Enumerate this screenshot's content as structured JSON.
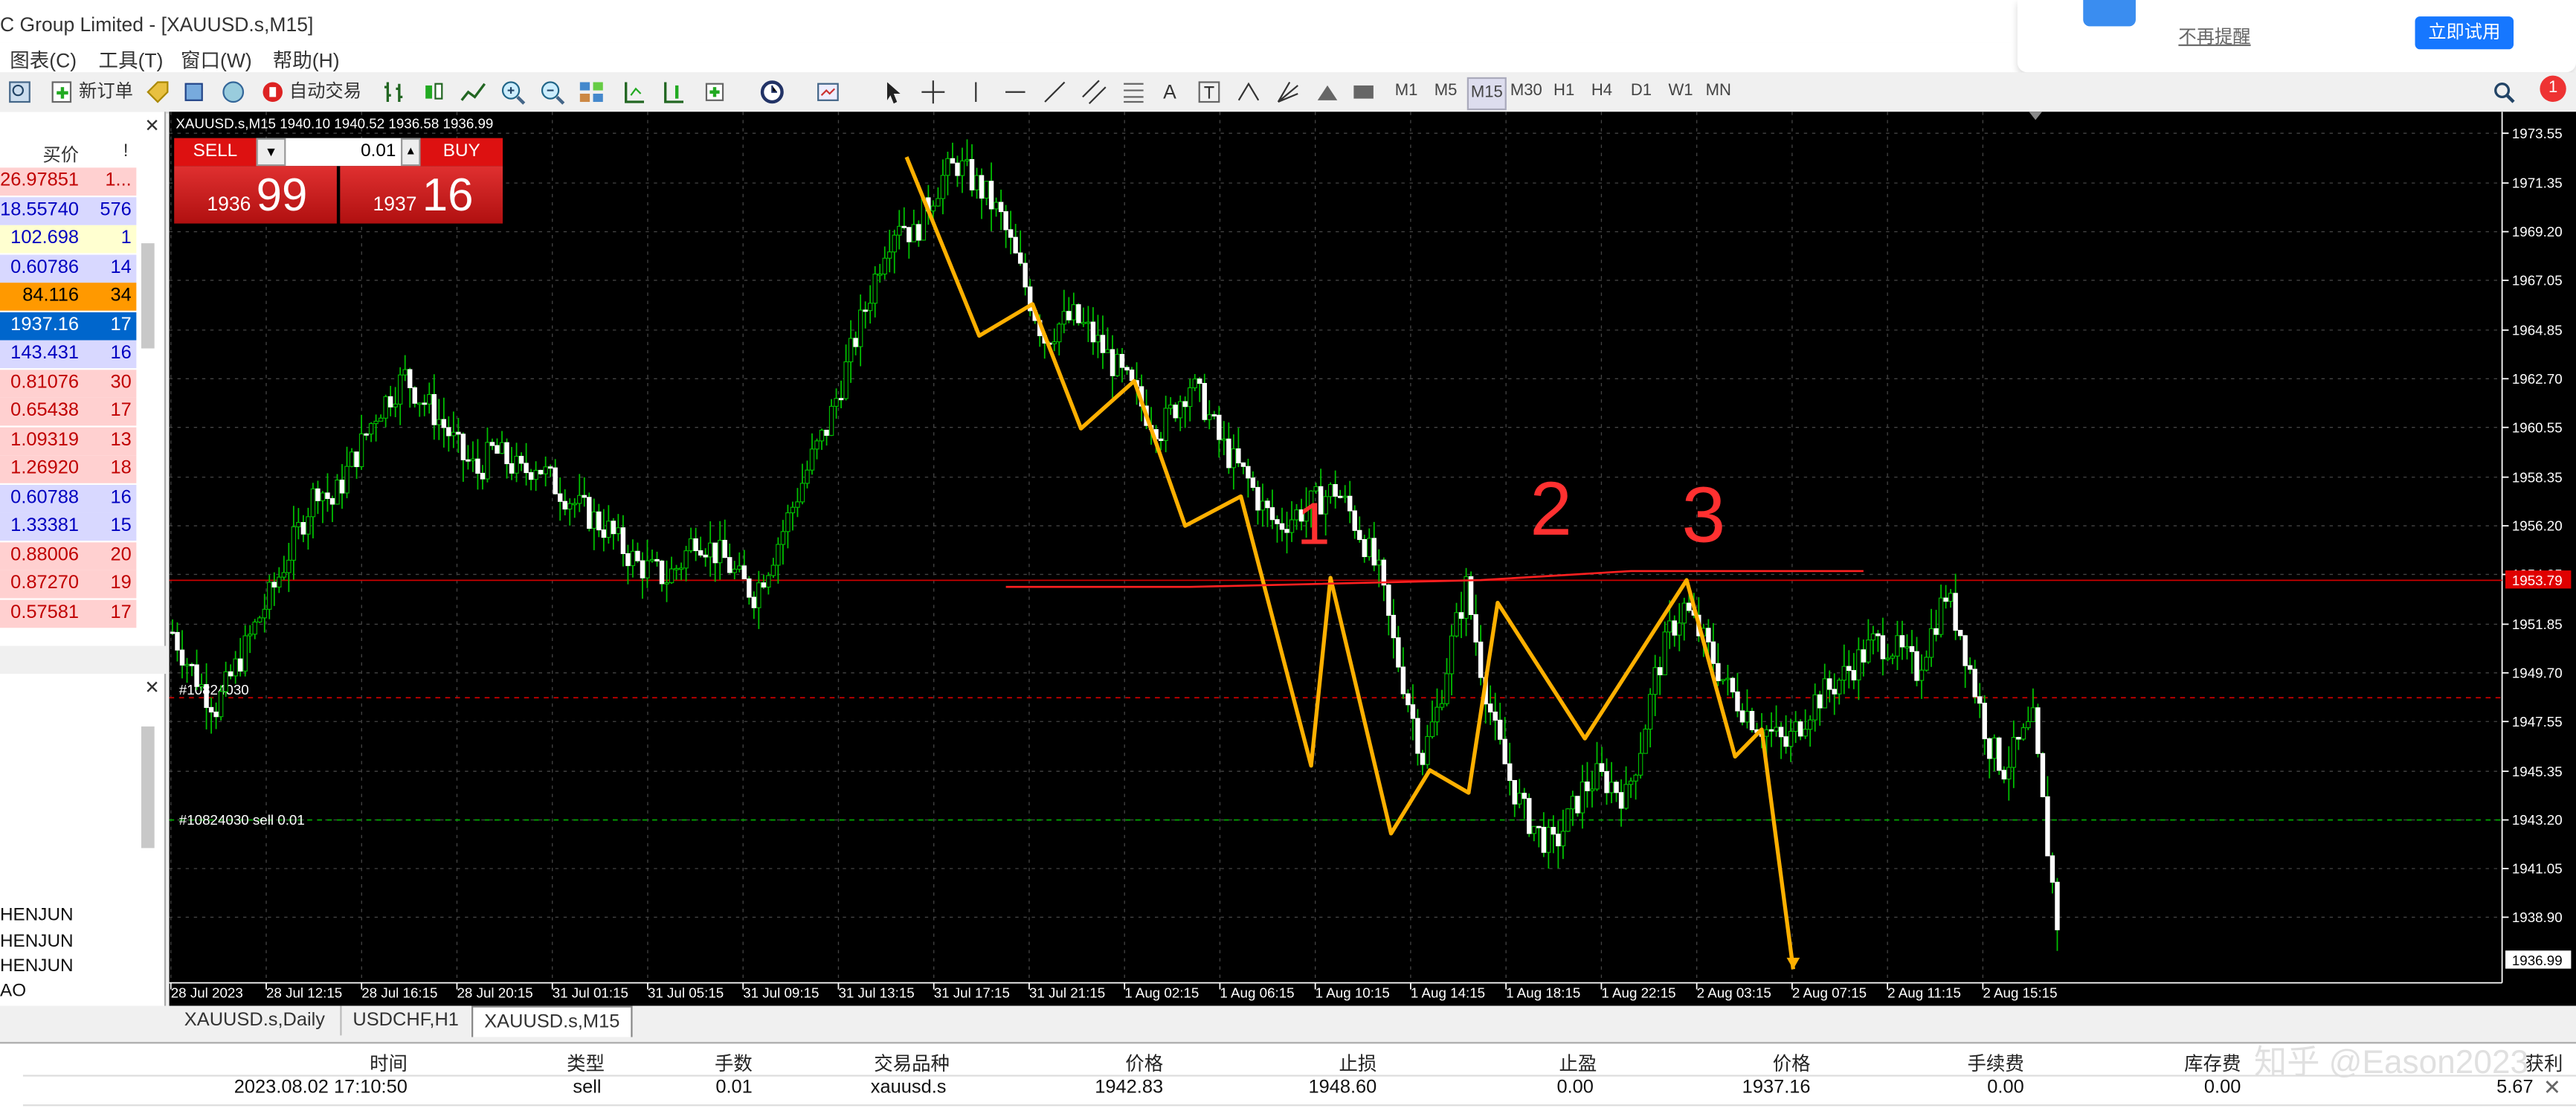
{
  "window": {
    "title": "C Group Limited - [XAUUSD.s,M15]"
  },
  "menu": [
    "图表(C)",
    "工具(T)",
    "窗口(W)",
    "帮助(H)"
  ],
  "toolbar": {
    "new_order": "新订单",
    "auto_trade": "自动交易",
    "timeframes": [
      "M1",
      "M5",
      "M15",
      "M30",
      "H1",
      "H4",
      "D1",
      "W1",
      "MN"
    ],
    "active_timeframe": "M15"
  },
  "popup": {
    "dismiss": "不再提醒",
    "try_now": "立即试用",
    "notif_count": "1"
  },
  "market_watch": {
    "col_bid": "买价",
    "col_bang": "!",
    "rows": [
      {
        "price": "26.97851",
        "spread": "1...",
        "bg": "#ffd0d0",
        "fg": "#c00000"
      },
      {
        "price": "18.55740",
        "spread": "576",
        "bg": "#d8d8ff",
        "fg": "#0000c0"
      },
      {
        "price": "102.698",
        "spread": "1",
        "bg": "#ffffd0",
        "fg": "#0000c0"
      },
      {
        "price": "0.60786",
        "spread": "14",
        "bg": "#d8d8ff",
        "fg": "#0000c0"
      },
      {
        "price": "84.116",
        "spread": "34",
        "bg": "#ff9900",
        "fg": "#000000"
      },
      {
        "price": "1937.16",
        "spread": "17",
        "bg": "#0066cc",
        "fg": "#ffffff"
      },
      {
        "price": "143.431",
        "spread": "16",
        "bg": "#d8d8ff",
        "fg": "#0000c0"
      },
      {
        "price": "0.81076",
        "spread": "30",
        "bg": "#ffd0d0",
        "fg": "#c00000"
      },
      {
        "price": "0.65438",
        "spread": "17",
        "bg": "#ffd0d0",
        "fg": "#c00000"
      },
      {
        "price": "1.09319",
        "spread": "13",
        "bg": "#ffd0d0",
        "fg": "#c00000"
      },
      {
        "price": "1.26920",
        "spread": "18",
        "bg": "#ffd0d0",
        "fg": "#c00000"
      },
      {
        "price": "0.60788",
        "spread": "16",
        "bg": "#d8d8ff",
        "fg": "#0000c0"
      },
      {
        "price": "1.33381",
        "spread": "15",
        "bg": "#d8d8ff",
        "fg": "#0000c0"
      },
      {
        "price": "0.88006",
        "spread": "20",
        "bg": "#ffd0d0",
        "fg": "#c00000"
      },
      {
        "price": "0.87270",
        "spread": "19",
        "bg": "#ffd0d0",
        "fg": "#c00000"
      },
      {
        "price": "0.57581",
        "spread": "17",
        "bg": "#ffd0d0",
        "fg": "#c00000"
      }
    ]
  },
  "navigator": {
    "items": [
      "HENJUN",
      "HENJUN",
      "HENJUN",
      "AO"
    ]
  },
  "one_click": {
    "sell": "SELL",
    "buy": "BUY",
    "volume": "0.01",
    "bid_small": "1936",
    "bid_big": "99",
    "ask_small": "1937",
    "ask_big": "16"
  },
  "chart_data": {
    "type": "candlestick",
    "symbol_info": "XAUUSD.s,M15  1940.10 1940.52 1936.58 1936.99",
    "y_ticks": [
      "1973.55",
      "1971.35",
      "1969.20",
      "1967.05",
      "1964.85",
      "1962.70",
      "1960.55",
      "1958.35",
      "1956.20",
      "1954.05",
      "1951.85",
      "1949.70",
      "1947.55",
      "1945.35",
      "1943.20",
      "1941.05",
      "1938.90"
    ],
    "ylim": [
      1936.0,
      1974.5
    ],
    "x_ticks": [
      "28 Jul 2023",
      "28 Jul 12:15",
      "28 Jul 16:15",
      "28 Jul 20:15",
      "31 Jul 01:15",
      "31 Jul 05:15",
      "31 Jul 09:15",
      "31 Jul 13:15",
      "31 Jul 17:15",
      "31 Jul 21:15",
      "1 Aug 02:15",
      "1 Aug 06:15",
      "1 Aug 10:15",
      "1 Aug 14:15",
      "1 Aug 18:15",
      "1 Aug 22:15",
      "2 Aug 03:15",
      "2 Aug 07:15",
      "2 Aug 11:15",
      "2 Aug 15:15"
    ],
    "close_path": [
      [
        0,
        1951.5
      ],
      [
        6,
        1950.2
      ],
      [
        12,
        1949.1
      ],
      [
        18,
        1948.2
      ],
      [
        24,
        1949.5
      ],
      [
        30,
        1950.8
      ],
      [
        36,
        1952.2
      ],
      [
        42,
        1953.5
      ],
      [
        48,
        1955.0
      ],
      [
        54,
        1956.5
      ],
      [
        60,
        1958.0
      ],
      [
        66,
        1957.2
      ],
      [
        72,
        1958.6
      ],
      [
        78,
        1959.8
      ],
      [
        84,
        1961.2
      ],
      [
        90,
        1962.0
      ],
      [
        96,
        1962.8
      ],
      [
        102,
        1961.9
      ],
      [
        108,
        1961.2
      ],
      [
        114,
        1960.3
      ],
      [
        120,
        1959.2
      ],
      [
        126,
        1958.6
      ],
      [
        132,
        1959.5
      ],
      [
        138,
        1959.1
      ],
      [
        144,
        1958.5
      ],
      [
        150,
        1959.0
      ],
      [
        156,
        1958.2
      ],
      [
        162,
        1957.6
      ],
      [
        168,
        1957.0
      ],
      [
        174,
        1956.5
      ],
      [
        180,
        1956.0
      ],
      [
        186,
        1955.2
      ],
      [
        192,
        1954.5
      ],
      [
        198,
        1954.2
      ],
      [
        204,
        1953.9
      ],
      [
        210,
        1954.6
      ],
      [
        216,
        1955.8
      ],
      [
        222,
        1955.2
      ],
      [
        228,
        1954.7
      ],
      [
        234,
        1953.8
      ],
      [
        240,
        1953.2
      ],
      [
        246,
        1954.5
      ],
      [
        252,
        1956.0
      ],
      [
        258,
        1957.6
      ],
      [
        264,
        1959.2
      ],
      [
        270,
        1960.5
      ],
      [
        276,
        1962.5
      ],
      [
        282,
        1964.5
      ],
      [
        288,
        1966.5
      ],
      [
        294,
        1968.6
      ],
      [
        300,
        1969.8
      ],
      [
        306,
        1969.0
      ],
      [
        312,
        1970.5
      ],
      [
        318,
        1971.6
      ],
      [
        324,
        1972.2
      ],
      [
        330,
        1971.5
      ],
      [
        336,
        1970.8
      ],
      [
        342,
        1969.8
      ],
      [
        348,
        1968.0
      ],
      [
        354,
        1966.2
      ],
      [
        360,
        1964.5
      ],
      [
        366,
        1965.1
      ],
      [
        372,
        1965.4
      ],
      [
        378,
        1964.8
      ],
      [
        384,
        1964.0
      ],
      [
        390,
        1963.1
      ],
      [
        396,
        1962.2
      ],
      [
        402,
        1961.2
      ],
      [
        408,
        1960.5
      ],
      [
        414,
        1961.5
      ],
      [
        420,
        1962.5
      ],
      [
        426,
        1961.5
      ],
      [
        432,
        1960.0
      ],
      [
        438,
        1959.0
      ],
      [
        444,
        1958.2
      ],
      [
        450,
        1957.0
      ],
      [
        456,
        1956.2
      ],
      [
        462,
        1956.6
      ],
      [
        468,
        1957.0
      ],
      [
        474,
        1957.4
      ],
      [
        480,
        1957.8
      ],
      [
        486,
        1956.8
      ],
      [
        492,
        1955.5
      ],
      [
        498,
        1954.0
      ],
      [
        504,
        1951.0
      ],
      [
        510,
        1948.5
      ],
      [
        516,
        1946.0
      ],
      [
        522,
        1948.0
      ],
      [
        528,
        1951.0
      ],
      [
        534,
        1953.5
      ],
      [
        540,
        1950.0
      ],
      [
        546,
        1947.0
      ],
      [
        552,
        1945.0
      ],
      [
        558,
        1943.5
      ],
      [
        564,
        1942.6
      ],
      [
        570,
        1942.0
      ],
      [
        576,
        1943.2
      ],
      [
        582,
        1944.5
      ],
      [
        588,
        1945.1
      ],
      [
        594,
        1944.8
      ],
      [
        600,
        1944.2
      ],
      [
        606,
        1946.5
      ],
      [
        612,
        1949.5
      ],
      [
        618,
        1951.5
      ],
      [
        624,
        1952.6
      ],
      [
        630,
        1951.5
      ],
      [
        636,
        1950.3
      ],
      [
        642,
        1949.0
      ],
      [
        648,
        1948.2
      ],
      [
        654,
        1947.5
      ],
      [
        660,
        1947.0
      ],
      [
        666,
        1946.5
      ],
      [
        672,
        1947.5
      ],
      [
        678,
        1948.5
      ],
      [
        684,
        1949.0
      ],
      [
        690,
        1949.6
      ],
      [
        696,
        1950.3
      ],
      [
        702,
        1951.0
      ],
      [
        708,
        1951.0
      ],
      [
        714,
        1950.5
      ],
      [
        720,
        1949.8
      ],
      [
        726,
        1951.5
      ],
      [
        732,
        1953.2
      ],
      [
        738,
        1951.5
      ],
      [
        744,
        1949.0
      ],
      [
        750,
        1946.5
      ],
      [
        756,
        1945.5
      ],
      [
        762,
        1946.5
      ],
      [
        768,
        1947.5
      ],
      [
        774,
        1942.0
      ],
      [
        780,
        1937.0
      ]
    ],
    "annotations": {
      "zigzag": [
        [
          303,
          1972.5
        ],
        [
          333,
          1964.6
        ],
        [
          355,
          1966.0
        ],
        [
          375,
          1960.5
        ],
        [
          397,
          1962.6
        ],
        [
          418,
          1956.2
        ],
        [
          441,
          1957.5
        ],
        [
          470,
          1945.6
        ],
        [
          478,
          1953.9
        ],
        [
          503,
          1942.6
        ],
        [
          519,
          1945.4
        ],
        [
          535,
          1944.4
        ],
        [
          547,
          1952.8
        ],
        [
          583,
          1946.8
        ],
        [
          625,
          1953.8
        ],
        [
          645,
          1946.0
        ],
        [
          656,
          1947.2
        ],
        [
          669,
          1936.6
        ]
      ],
      "level_line": [
        [
          344,
          1953.5
        ],
        [
          420,
          1953.5
        ],
        [
          540,
          1953.8
        ],
        [
          602,
          1954.2
        ],
        [
          698,
          1954.2
        ]
      ],
      "labels": [
        "1",
        "2",
        "3"
      ]
    },
    "order_lines": [
      {
        "label": "#10824030 sell 0.01",
        "price": 1943.2,
        "color": "#00aa00"
      },
      {
        "label": "#10824030 sl",
        "price": 1948.6,
        "color": "#cc0000"
      }
    ],
    "bid_line": 1953.79,
    "bid_label": "1953.79",
    "current_price_label": "1936.99",
    "order_1_label": "#10824030"
  },
  "tabs": [
    {
      "label": "XAUUSD.s,Daily",
      "active": false
    },
    {
      "label": "USDCHF,H1",
      "active": false
    },
    {
      "label": "XAUUSD.s,M15",
      "active": true
    }
  ],
  "terminal": {
    "headers": [
      "时间",
      "类型",
      "手数",
      "交易品种",
      "价格",
      "止损",
      "止盈",
      "价格",
      "手续费",
      "库存费",
      "获利"
    ],
    "row": [
      "2023.08.02 17:10:50",
      "sell",
      "0.01",
      "xauusd.s",
      "1942.83",
      "1948.60",
      "0.00",
      "1937.16",
      "0.00",
      "0.00",
      "5.67"
    ]
  },
  "watermark": "知乎 @Eason2023"
}
